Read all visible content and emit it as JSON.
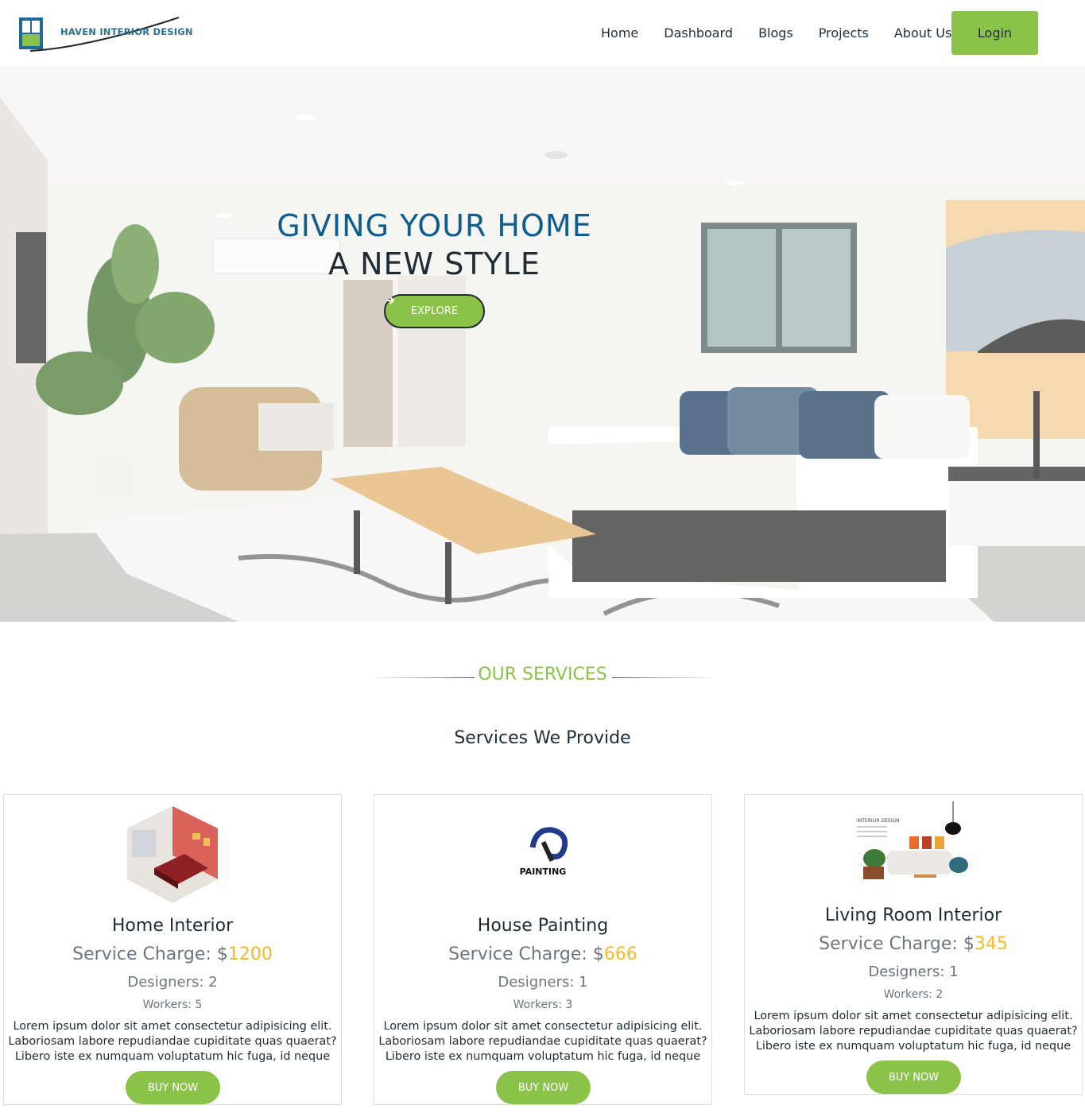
{
  "header": {
    "logo_text": "HAVEN INTERIOR DESIGN",
    "nav": [
      "Home",
      "Dashboard",
      "Blogs",
      "Projects",
      "About Us"
    ],
    "login_label": "Login"
  },
  "hero": {
    "line1": "GIVING YOUR HOME",
    "line2": "A NEW STYLE",
    "explore_label": "EXPLORE",
    "explore_icon": "arrow-right-icon"
  },
  "services": {
    "tag": "OUR SERVICES",
    "subtitle": "Services We Provide",
    "cards": [
      {
        "title": "Home Interior",
        "charge_label": "Service Charge: $",
        "price": "1200",
        "designers": "Designers: 2",
        "workers": "Workers: 5",
        "description": "Lorem ipsum dolor sit amet consectetur adipisicing elit. Laboriosam labore repudiandae cupiditate quas quaerat? Libero iste ex numquam voluptatum hic fuga, id neque",
        "buy_label": "BUY NOW"
      },
      {
        "title": "House Painting",
        "charge_label": "Service Charge: $",
        "price": "666",
        "designers": "Designers: 1",
        "workers": "Workers: 3",
        "image_text": "PAINTING",
        "description": "Lorem ipsum dolor sit amet consectetur adipisicing elit. Laboriosam labore repudiandae cupiditate quas quaerat? Libero iste ex numquam voluptatum hic fuga, id neque",
        "buy_label": "BUY NOW"
      },
      {
        "title": "Living Room Interior",
        "charge_label": "Service Charge: $",
        "price": "345",
        "designers": "Designers: 1",
        "workers": "Workers: 2",
        "image_text": "INTERIOR DESIGN",
        "description": "Lorem ipsum dolor sit amet consectetur adipisicing elit. Laboriosam labore repudiandae cupiditate quas quaerat? Libero iste ex numquam voluptatum hic fuga, id neque",
        "buy_label": "BUY NOW"
      }
    ]
  },
  "colors": {
    "accent_green": "#8bc34a",
    "price_yellow": "#f5b921",
    "hero_blue": "#0f5c8f"
  }
}
